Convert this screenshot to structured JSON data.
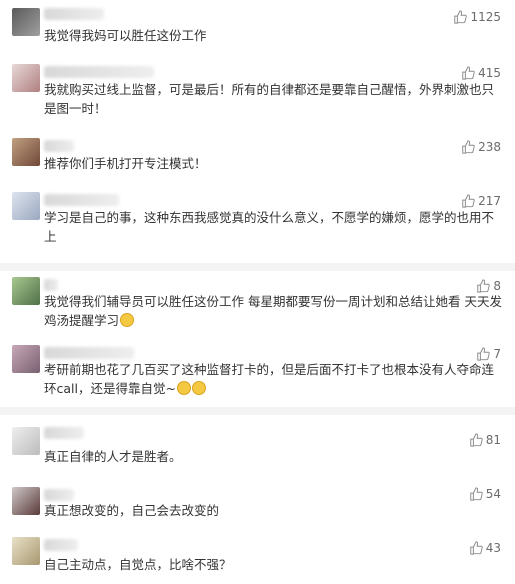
{
  "comments": [
    {
      "text": "我觉得我妈可以胜任这份工作",
      "likes": "1125"
    },
    {
      "text": "我就购买过线上监督，可是最后！所有的自律都还是要靠自己醒悟，外界刺激也只是图一时！",
      "likes": "415"
    },
    {
      "text": "推荐你们手机打开专注模式！",
      "likes": "238"
    },
    {
      "text": "学习是自己的事，这种东西我感觉真的没什么意义，不愿学的嫌烦，愿学的也用不上",
      "likes": "217"
    },
    {
      "text": "我觉得我们辅导员可以胜任这份工作 每星期都要写份一周计划和总结让她看 天天发鸡汤提醒学习",
      "likes": "8"
    },
    {
      "text": "考研前期也花了几百买了这种监督打卡的，但是后面不打卡了也根本没有人夺命连环call，还是得靠自觉~",
      "likes": "7"
    },
    {
      "text": "真正自律的人才是胜者。",
      "likes": "81"
    },
    {
      "text": "真正想改变的，自己会去改变的",
      "likes": "54"
    },
    {
      "text": "自己主动点，自觉点，比啥不强？",
      "likes": "43"
    }
  ],
  "icons": {
    "like": "thumbs-up-icon",
    "emoji": "face-emoji-icon"
  },
  "colors": {
    "background": "#f3f3f3",
    "card": "#ffffff",
    "text": "#333333",
    "meta": "#6b6b6b"
  }
}
